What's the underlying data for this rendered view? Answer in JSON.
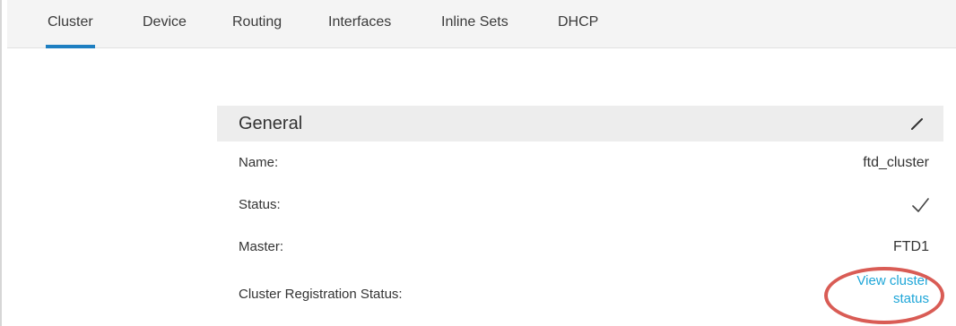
{
  "tabs": [
    {
      "label": "Cluster",
      "active": true
    },
    {
      "label": "Device",
      "active": false
    },
    {
      "label": "Routing",
      "active": false
    },
    {
      "label": "Interfaces",
      "active": false
    },
    {
      "label": "Inline Sets",
      "active": false
    },
    {
      "label": "DHCP",
      "active": false
    }
  ],
  "general": {
    "title": "General",
    "edit_icon": "pencil-icon",
    "rows": [
      {
        "label": "Name:",
        "value": "ftd_cluster"
      },
      {
        "label": "Status:",
        "value_icon": "checkmark-icon"
      },
      {
        "label": "Master:",
        "value": "FTD1"
      },
      {
        "label": "Cluster Registration Status:",
        "link": "View cluster status"
      }
    ]
  },
  "colors": {
    "accent": "#1e7fc1",
    "link": "#1ea6d8",
    "highlight_ring": "#d95c55",
    "header_bg": "#ededed"
  }
}
